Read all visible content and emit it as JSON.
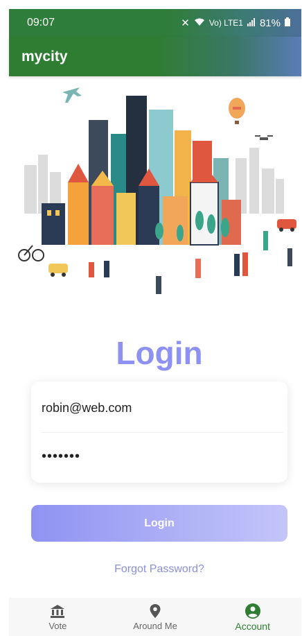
{
  "status_bar": {
    "time": "09:07",
    "network": "Vo) LTE1",
    "battery": "81%"
  },
  "app_bar": {
    "title": "mycity"
  },
  "login": {
    "title": "Login",
    "email_value": "robin@web.com",
    "password_value": "•••••••",
    "button_label": "Login",
    "forgot_label": "Forgot Password?"
  },
  "bottom_nav": {
    "items": [
      {
        "label": "Vote",
        "icon": "bank-icon"
      },
      {
        "label": "Around Me",
        "icon": "location-pin-icon"
      },
      {
        "label": "Account",
        "icon": "account-circle-icon",
        "active": true
      }
    ]
  },
  "colors": {
    "primary_green": "#2e7d32",
    "login_accent": "#8c91f2",
    "forgot_link": "#8a8fd6"
  }
}
